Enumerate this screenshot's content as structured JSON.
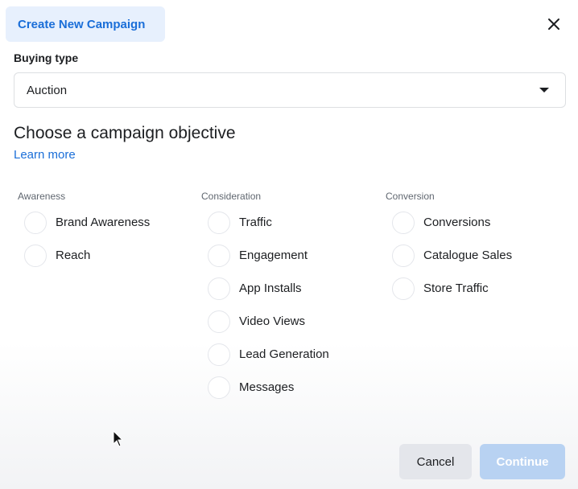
{
  "dialog": {
    "title": "Create New Campaign",
    "close_icon": "close-icon"
  },
  "buying_type": {
    "label": "Buying type",
    "value": "Auction",
    "dropdown_icon": "caret-down-icon"
  },
  "objective": {
    "heading": "Choose a campaign objective",
    "learn_more": "Learn more",
    "columns": [
      {
        "label": "Awareness",
        "options": [
          "Brand Awareness",
          "Reach"
        ]
      },
      {
        "label": "Consideration",
        "options": [
          "Traffic",
          "Engagement",
          "App Installs",
          "Video Views",
          "Lead Generation",
          "Messages"
        ]
      },
      {
        "label": "Conversion",
        "options": [
          "Conversions",
          "Catalogue Sales",
          "Store Traffic"
        ]
      }
    ]
  },
  "footer": {
    "cancel_label": "Cancel",
    "continue_label": "Continue"
  },
  "colors": {
    "accent": "#1a6ed8",
    "title_tab_bg": "#e7f0fd",
    "continue_disabled": "#b8d2f2",
    "cancel_bg": "#e4e6eb"
  }
}
